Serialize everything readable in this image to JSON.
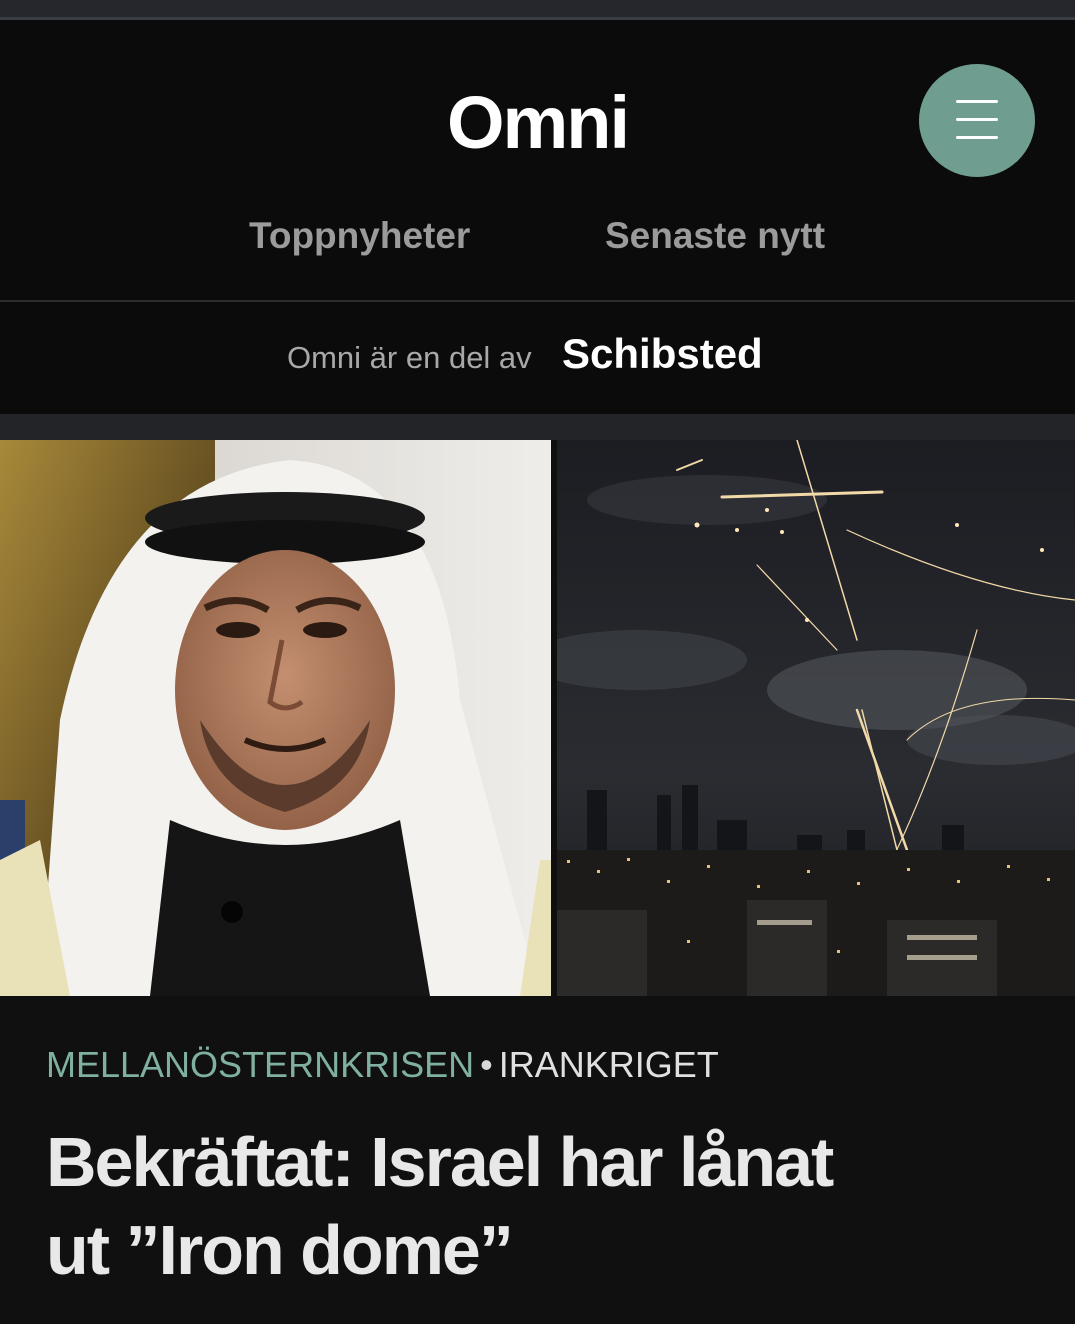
{
  "header": {
    "logo": "Omni",
    "menu_icon": "hamburger-icon"
  },
  "nav": {
    "items": [
      {
        "label": "Toppnyheter"
      },
      {
        "label": "Senaste nytt"
      }
    ]
  },
  "partner": {
    "text": "Omni är en del av",
    "logo": "Schibsted"
  },
  "article": {
    "category": "MELLANÖSTERNKRISEN",
    "separator": "•",
    "subcategory": "IRANKRIGET",
    "headline": "Bekräftat: Israel har lånat ut ”Iron dome”"
  },
  "colors": {
    "accent": "#6f9e90",
    "category": "#7fb0a2",
    "background": "#0d0d0d"
  }
}
